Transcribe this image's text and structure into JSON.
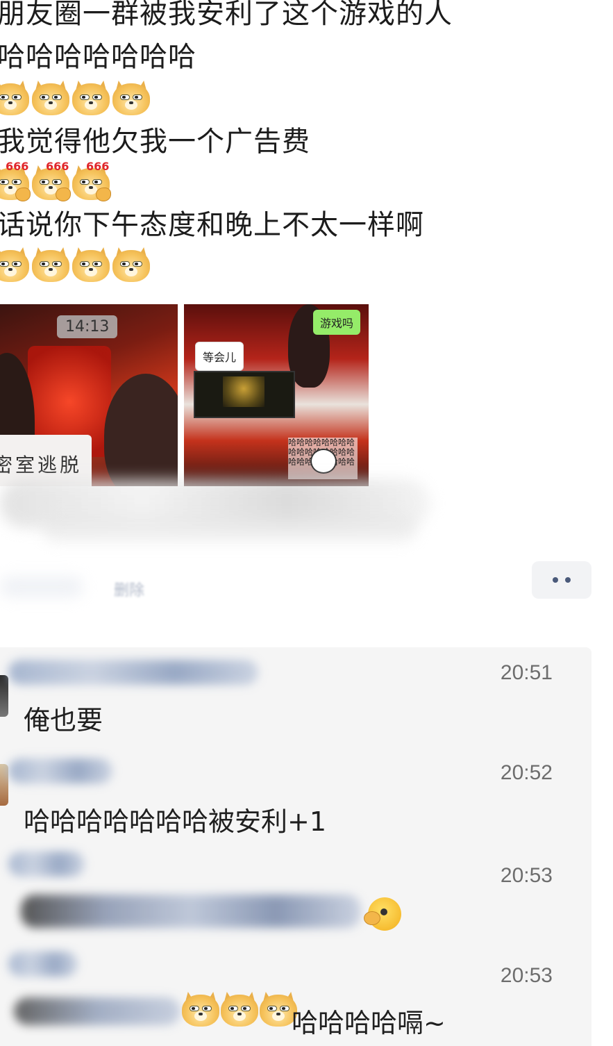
{
  "post": {
    "lines": [
      "朋友圈一群被我安利了这个游戏的人",
      "哈哈哈哈哈哈哈",
      "我觉得他欠我一个广告费",
      "话说你下午态度和晚上不太一样啊"
    ],
    "emoji_rows": [
      {
        "type": "doge-icon",
        "count": 4
      },
      {
        "type": "doge-666-icon",
        "count": 3,
        "badge": "666"
      },
      {
        "type": "doge-icon",
        "count": 4
      }
    ]
  },
  "images": {
    "left": {
      "time": "14:13",
      "caption": "密室逃脱"
    },
    "right": {
      "green_bubble": "游戏吗",
      "white_bubble": "等会儿",
      "haha_text": "哈哈哈哈哈哈哈哈哈哈哈哈哈哈哈哈哈哈哈哈哈哈哈哈"
    }
  },
  "actions": {
    "delete_label": "删除",
    "more_icon": "more-dots-icon"
  },
  "comments": [
    {
      "time": "20:51",
      "text": "俺也要"
    },
    {
      "time": "20:52",
      "text": "哈哈哈哈哈哈哈被安利+1"
    },
    {
      "time": "20:53",
      "text": ""
    },
    {
      "time": "20:53",
      "text": "哈哈哈哈嗝~"
    }
  ]
}
